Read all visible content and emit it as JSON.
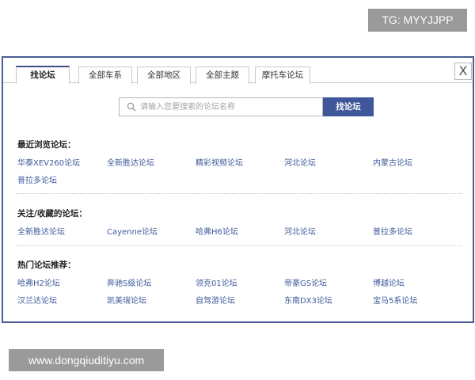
{
  "watermarks": {
    "top": "TG: MYYJJPP",
    "bottom": "www.dongqiuditiyu.com"
  },
  "tabs": [
    {
      "label": "找论坛",
      "active": true
    },
    {
      "label": "全部车系",
      "active": false
    },
    {
      "label": "全部地区",
      "active": false
    },
    {
      "label": "全部主题",
      "active": false
    },
    {
      "label": "摩托车论坛",
      "active": false
    }
  ],
  "close_label": "X",
  "search": {
    "placeholder": "请输入您要搜索的论坛名称",
    "button_label": "找论坛"
  },
  "sections": [
    {
      "title": "最近浏览论坛：",
      "links": [
        "华泰XEV260论坛",
        "全新胜达论坛",
        "精彩视频论坛",
        "河北论坛",
        "内蒙古论坛",
        "普拉多论坛"
      ]
    },
    {
      "title": "关注/收藏的论坛：",
      "links": [
        "全新胜达论坛",
        "Cayenne论坛",
        "哈弗H6论坛",
        "河北论坛",
        "普拉多论坛"
      ]
    },
    {
      "title": "热门论坛推荐：",
      "links": [
        "哈弗H2论坛",
        "奔驰S级论坛",
        "领克01论坛",
        "帝豪GS论坛",
        "博越论坛",
        "汉兰达论坛",
        "凯美瑞论坛",
        "自驾游论坛",
        "东南DX3论坛",
        "宝马5系论坛"
      ]
    }
  ],
  "colors": {
    "frame": "#4b5f94",
    "accent": "#3f569a",
    "link": "#3d5a9a"
  }
}
